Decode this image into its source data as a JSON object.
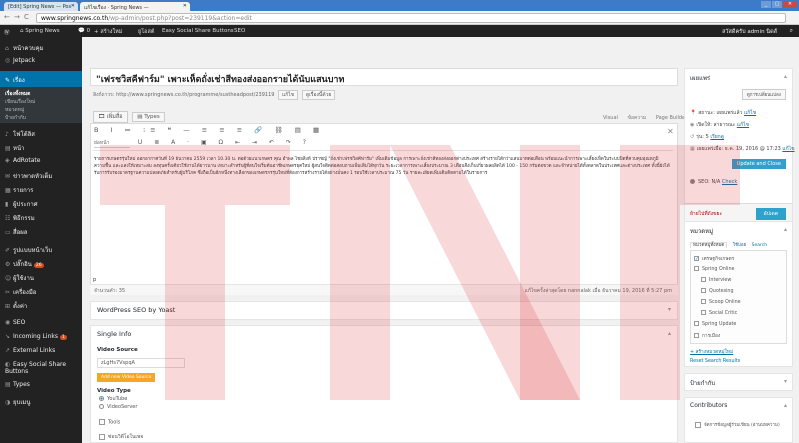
{
  "browser": {
    "tabs": [
      {
        "label": "[Edit] Spring News — Pos",
        "active": false
      },
      {
        "label": "แก้ไขเรื่อง · Spring News — ",
        "active": true
      }
    ],
    "url_domain": "www.springnews.co.th",
    "url_path": "/wp-admin/post.php?post=239119&action=edit",
    "window_controls": [
      "_",
      "▢",
      "✕"
    ]
  },
  "admin_bar": {
    "site_name": "Spring News",
    "comments_count": "0",
    "new_label": "+ สร้างใหม่",
    "seo_label": "ยูโอสต์",
    "share_label": "Easy Social Share Buttons",
    "seo2_label": "SEO",
    "howdy": "สวัสดีครับ admin นิดส์"
  },
  "menu": {
    "items": [
      {
        "icon": "⌂",
        "label": "หน้าควบคุม"
      },
      {
        "icon": "◎",
        "label": "Jetpack"
      },
      {
        "icon": "✎",
        "label": "เรื่อง",
        "current": true
      },
      {
        "icon": "♪",
        "label": "โฟโต้ลิส"
      },
      {
        "icon": "▤",
        "label": "หน้า"
      },
      {
        "icon": "◈",
        "label": "AdRotate"
      },
      {
        "icon": "✉",
        "label": "ข่าวพาดหัวเต็ม"
      },
      {
        "icon": "▦",
        "label": "รายการ"
      },
      {
        "icon": "▮",
        "label": "ผู้ประกาศ"
      },
      {
        "icon": "☷",
        "label": "พิธีกรรม"
      },
      {
        "icon": "▭",
        "label": "สื่อผล"
      },
      {
        "icon": "✐",
        "label": "รูปแบบหน้าเว็บ"
      },
      {
        "icon": "⚙",
        "label": "ปลั๊กอิน",
        "badge": "26"
      },
      {
        "icon": "☺",
        "label": "ผู้ใช้งาน"
      },
      {
        "icon": "✂",
        "label": "เครื่องมือ"
      },
      {
        "icon": "⊞",
        "label": "ตั้งค่า"
      },
      {
        "icon": "◉",
        "label": "SEO"
      },
      {
        "icon": "↘",
        "label": "Incoming Links",
        "badge": "1"
      },
      {
        "icon": "↗",
        "label": "External Links"
      },
      {
        "icon": "◐",
        "label": "Easy Social Share Buttons"
      },
      {
        "icon": "▤",
        "label": "Types"
      },
      {
        "icon": "◑",
        "label": "ยุบเมนู"
      }
    ],
    "submenu": [
      "เรื่องทั้งหมด",
      "เขียนเรื่องใหม่",
      "หมวดหมู่",
      "ป้ายกำกับ"
    ]
  },
  "post": {
    "title": "\"เฟรชวิสคีฟาร์ม\" เพาะเห็ดถั่งเช่าสีทองส่งออกรายได้นับแสนบาท",
    "permalink_label": "ลิงก์ถาวร: http://www.springnews.co.th/programme/sustheadpost/239119",
    "permalink_edit": "แก้ไข",
    "permalink_view": "ดูเรื่องนี้ด้วย",
    "add_media": "เพิ่มสื่อ",
    "types_btn": "Types",
    "editor_tabs": [
      "Visual",
      "ข้อความ",
      "Page Builder"
    ],
    "format": "ย่อหน้า",
    "toolbar1": "B I ≔ ⁝≡ ❝ — ≡ ≡ ≡ 🔗 ⛓ ▤ ▦",
    "toolbar2": "U ≣ A · ▣ Ω ⇤ ⇥ ↶ ↷ ?",
    "body": "รายการเกษตรรุ่นใหม่ ออกอากาศวันที่ 19 ธันวาคม 2559 เวลา 10.30 น. ต่อด้วยแนวเกษตร คุณ อำพล ไชยสิงห์ ปราชญ์ \"ถั่งเช่าเฟรชวิสคีฟาร์ม\" เพิ่มเติมข้อมูล การเพาะถั่งเช่าสีทองส่งออกต่างประเทศ สร้างรายได้กว่าแสนบาทต่อเดือน พร้อมแนะนำการเพาะเลี้ยงเห็ดในระบบปิดที่ควบคุมอุณหภูมิ ความชื้น และแสงให้เหมาะสม ลงทุนครั้งเดียวใช้งานได้ยาวนาน เหมาะสำหรับผู้ที่สนใจเริ่มต้นอาชีพเกษตรยุคใหม่ ผู้สนใจติดต่อสอบถามเพิ่มเติมได้ทุกวัน ระยะเวลาการเพาะเลี้ยงประมาณ 3 เดือนจึงเก็บเกี่ยวผลผลิตได้ 100 - 150 กรัมต่อขวด และจำหน่ายได้ทั้งตลาดในประเทศและต่างประเทศ ทั้งนี้ยังได้รับการรับรองมาตรฐานความปลอดภัยสำหรับผู้บริโภค ซึ่งถือเป็นอีกหนึ่งทางเลือกของเกษตรกรรุ่นใหม่ที่ต้องการสร้างรายได้อย่างมั่นคง 1 รอบใช้เวลาประมาณ 75 วัน รายละเอียดเพิ่มเติมติดตามได้ในรายการ",
    "cursor": "p",
    "word_count": "จำนวนคำ: 35",
    "last_edited": "แก้ไขครั้งล่าสุดโดย nannalak เมื่อ ธันวาคม 19, 2016 ที่ 5:27 pm"
  },
  "seo_box": {
    "title": "WordPress SEO by Yoast"
  },
  "single_info": {
    "title": "Single Info",
    "video_source_label": "Video Source",
    "video_source_value": "zLgHs7VspqA",
    "add_video_btn": "Add new Video Source",
    "video_type_label": "Video Type",
    "video_types": [
      {
        "label": "YouTube",
        "checked": true
      },
      {
        "label": "VideoServer",
        "checked": false
      }
    ],
    "tools_label": "Tools",
    "checkbox_label": "ซ่อนวิดีโอในเพจ"
  },
  "publish": {
    "title": "เผยแพร่",
    "preview": "ดูการเปลี่ยนแปลง",
    "status": "สถานะ: เผยแพร่แล้ว",
    "visibility": "เปิดให้: สาธารณะ",
    "revisions": "รุ่น: 5",
    "revisions_link": "เรียกดู",
    "published_on": "เผยแพร่เมื่อ: ธ.ค. 19, 2016 @ 17:23",
    "edit": "แก้ไข",
    "update_close": "Update and Close",
    "seo_label": "SEO: N/A",
    "seo_check": "Check",
    "trash": "ย้ายไปที่ถังขยะ",
    "update": "อัปเดต"
  },
  "categories": {
    "title": "หมวดหมู่",
    "tabs": [
      "หมวดหมู่ทั้งหมด",
      "ใช้บ่อย",
      "Search"
    ],
    "items": [
      {
        "label": "เศรษฐกิจเกษตร",
        "checked": true,
        "indent": 0
      },
      {
        "label": "Spring Online",
        "checked": false,
        "indent": 0
      },
      {
        "label": "Interview",
        "checked": false,
        "indent": 1
      },
      {
        "label": "Quotesing",
        "checked": false,
        "indent": 1
      },
      {
        "label": "Scoop Online",
        "checked": false,
        "indent": 1
      },
      {
        "label": "Social Critic",
        "checked": false,
        "indent": 1
      },
      {
        "label": "Spring Update",
        "checked": false,
        "indent": 0
      },
      {
        "label": "การเมือง",
        "checked": false,
        "indent": 0
      }
    ],
    "add_new": "+ สร้างหมวดหมู่ใหม่",
    "reset": "Reset Search Results"
  },
  "tags": {
    "title": "ป้ายกำกับ"
  },
  "contributors": {
    "title": "Contributors",
    "row": "จัดการข้อมูลผู้ร่วมเขียน (อ่านบทความ)"
  },
  "colors": {
    "admin_menu": "#222222",
    "accent": "#0073aa",
    "button": "#2ea2cc",
    "watermark": "#d7262a"
  }
}
